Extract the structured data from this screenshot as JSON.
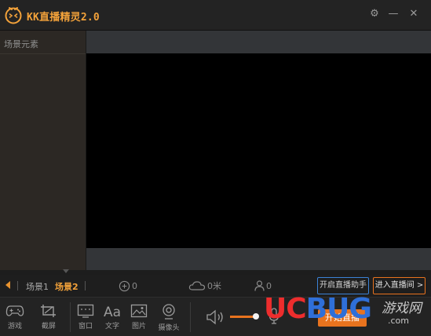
{
  "app": {
    "title": "KK直播精灵2.0"
  },
  "sidebar": {
    "header": "场景元素"
  },
  "scenes": {
    "items": [
      "场景1",
      "场景2"
    ],
    "active_index": 1
  },
  "stats": {
    "gifts": "0",
    "clouds": "0米",
    "viewers": "0"
  },
  "actions": {
    "assistant": "开启直播助手",
    "enter_room": "进入直播间 >"
  },
  "tools": [
    {
      "label": "游戏",
      "icon": "gamepad-icon"
    },
    {
      "label": "截屏",
      "icon": "crop-icon"
    },
    {
      "label": "窗口",
      "icon": "window-icon"
    },
    {
      "label": "文字",
      "icon": "text-icon"
    },
    {
      "label": "图片",
      "icon": "image-icon"
    },
    {
      "label": "摄像头",
      "icon": "camera-icon"
    }
  ],
  "audio": {
    "volume_level": 0.85
  },
  "start_live": "开始直播",
  "watermark": {
    "brand": "UCBUG",
    "cn": "游戏网",
    "domain": ".com"
  },
  "colors": {
    "accent": "#e8731e",
    "title": "#f3a23a",
    "active_scene": "#f3a23a",
    "outline_blue": "#3b82d6"
  }
}
